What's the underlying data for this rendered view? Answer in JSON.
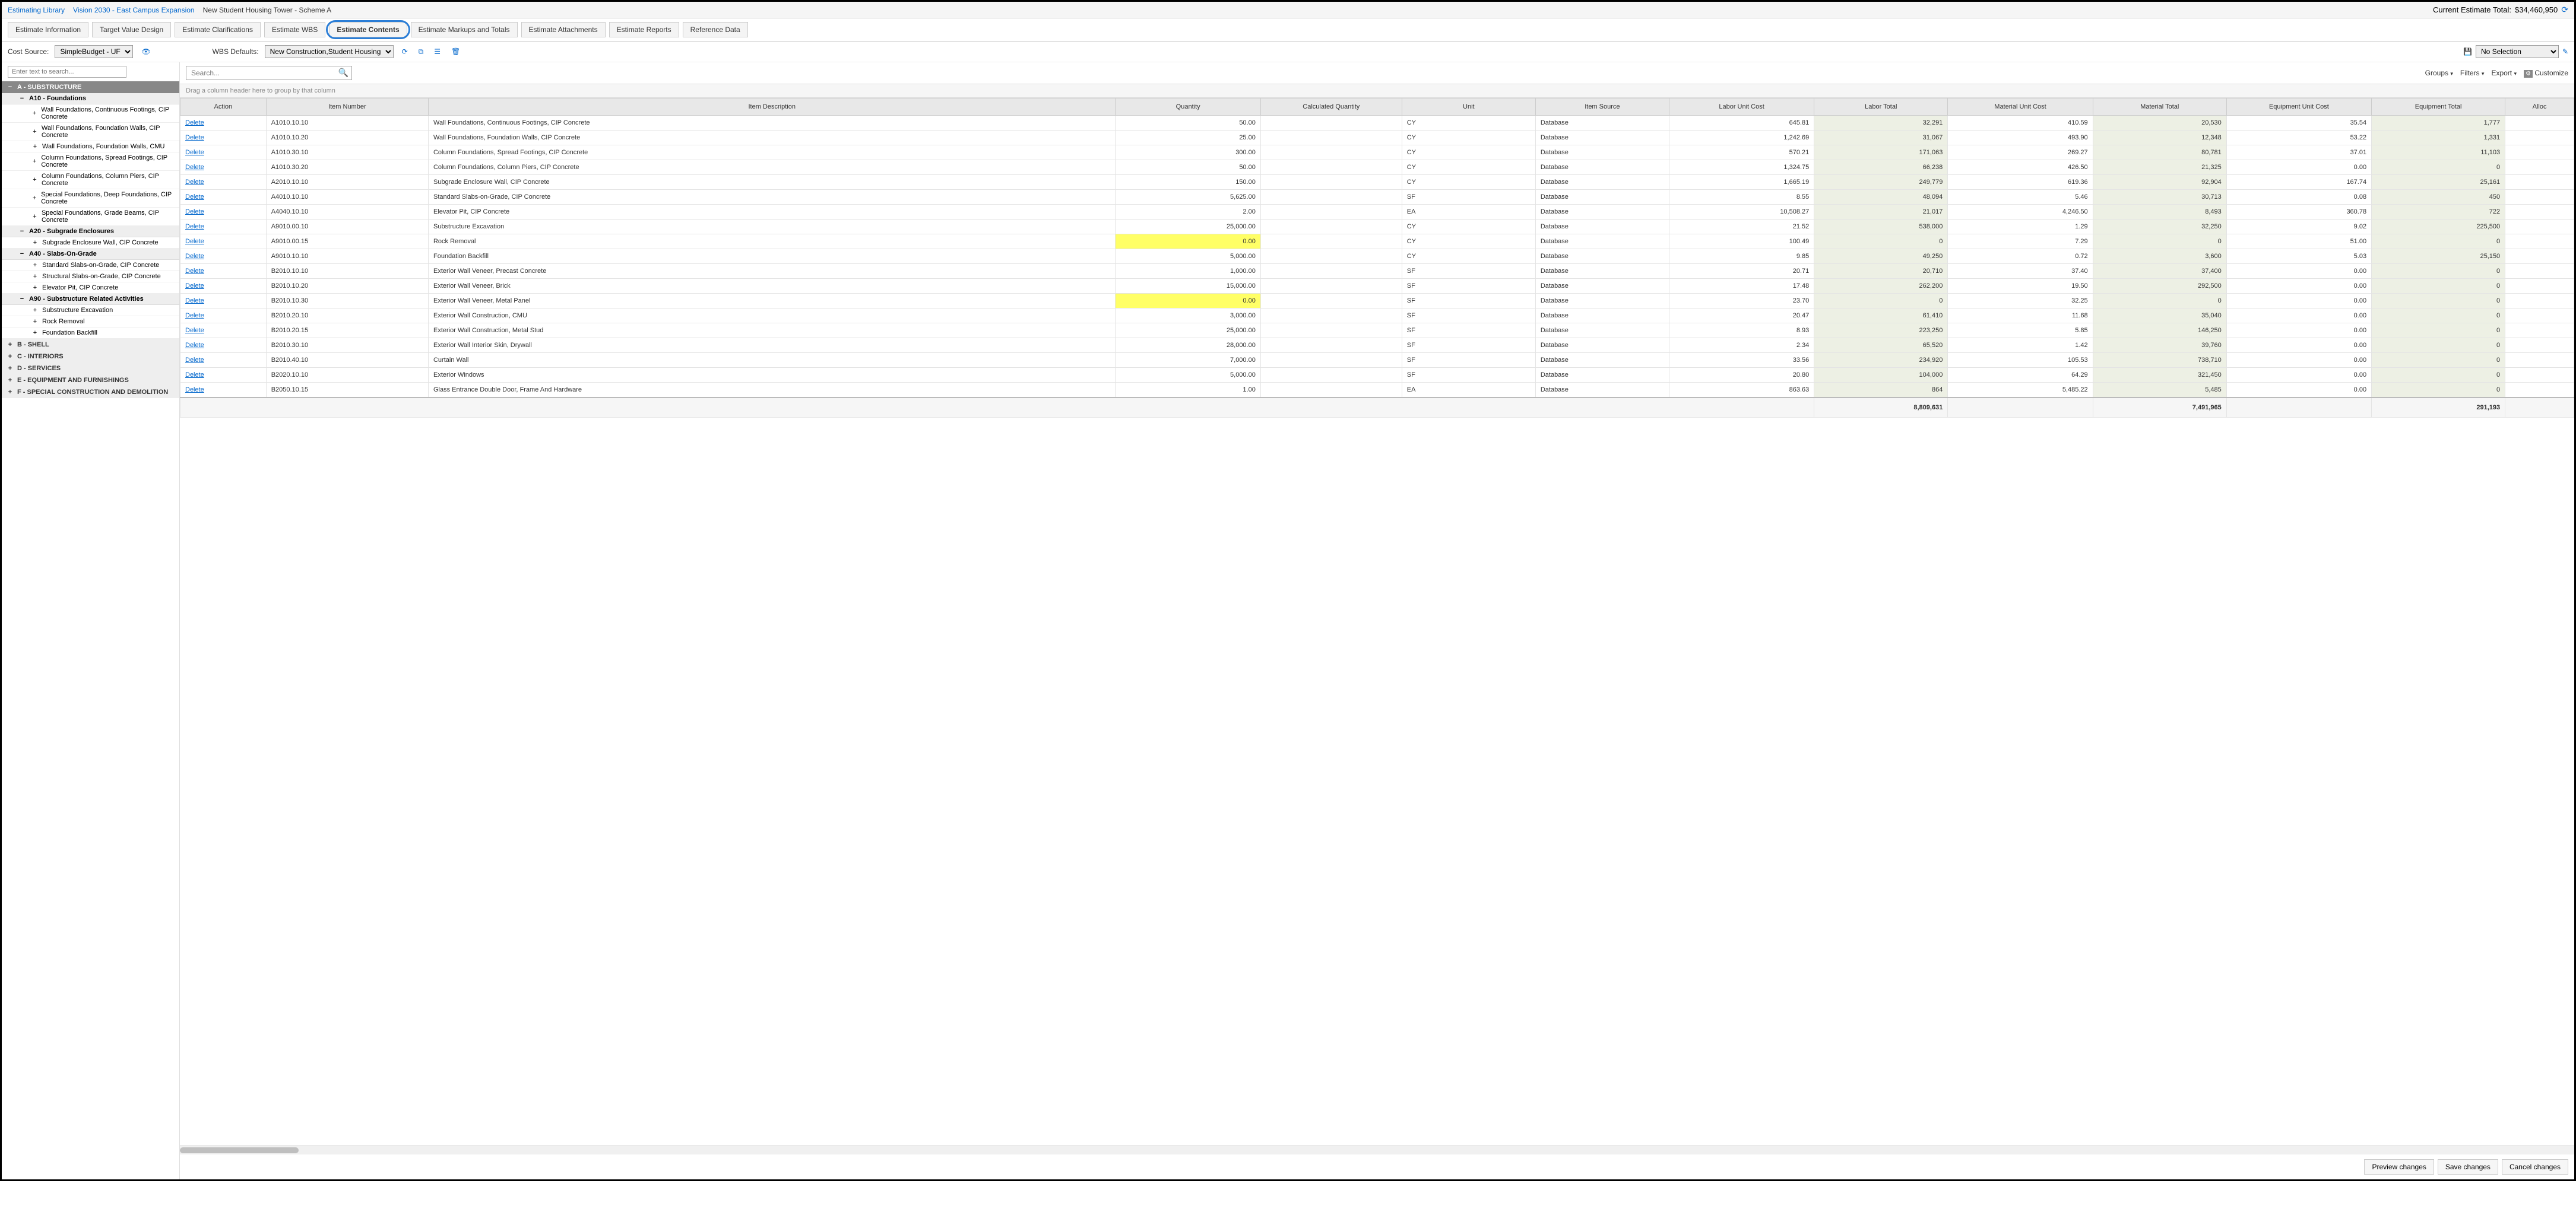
{
  "breadcrumb": {
    "libLabel": "Estimating Library",
    "programLabel": "Vision 2030 - East Campus Expansion",
    "projectLabel": "New Student Housing Tower - Scheme A"
  },
  "totalLabel": "Current Estimate Total:",
  "totalValue": "$34,460,950",
  "tabs": [
    "Estimate Information",
    "Target Value Design",
    "Estimate Clarifications",
    "Estimate WBS",
    "Estimate Contents",
    "Estimate Markups and Totals",
    "Estimate Attachments",
    "Estimate Reports",
    "Reference Data"
  ],
  "activeTabIndex": 4,
  "costSourceLabel": "Cost Source:",
  "costSourceValue": "SimpleBudget - UF",
  "wbsDefaultsLabel": "WBS Defaults:",
  "wbsDefaultsValue": "New Construction,Student Housing",
  "noSelectionLabel": "No Selection",
  "sidebarSearchPlaceholder": "Enter text to search...",
  "tree": {
    "A": {
      "title": "A - SUBSTRUCTURE",
      "A10": {
        "title": "A10 - Foundations",
        "items": [
          "Wall Foundations, Continuous Footings, CIP Concrete",
          "Wall Foundations, Foundation Walls, CIP Concrete",
          "Wall Foundations, Foundation Walls, CMU",
          "Column Foundations, Spread Footings, CIP Concrete",
          "Column Foundations, Column Piers, CIP Concrete",
          "Special Foundations, Deep Foundations, CIP Concrete",
          "Special Foundations, Grade Beams, CIP Concrete"
        ]
      },
      "A20": {
        "title": "A20 - Subgrade Enclosures",
        "items": [
          "Subgrade Enclosure Wall, CIP Concrete"
        ]
      },
      "A40": {
        "title": "A40 - Slabs-On-Grade",
        "items": [
          "Standard Slabs-on-Grade, CIP Concrete",
          "Structural Slabs-on-Grade, CIP Concrete",
          "Elevator Pit, CIP Concrete"
        ]
      },
      "A90": {
        "title": "A90 - Substructure Related Activities",
        "items": [
          "Substructure Excavation",
          "Rock Removal",
          "Foundation Backfill"
        ]
      }
    },
    "B": "B - SHELL",
    "C": "C - INTERIORS",
    "D": "D - SERVICES",
    "E": "E - EQUIPMENT AND FURNISHINGS",
    "F": "F - SPECIAL CONSTRUCTION AND DEMOLITION"
  },
  "contentSearchPlaceholder": "Search...",
  "toolbarRight": {
    "groups": "Groups",
    "filters": "Filters",
    "export": "Export",
    "customize": "Customize"
  },
  "groupBarText": "Drag a column header here to group by that column",
  "columns": [
    "Action",
    "Item Number",
    "Item Description",
    "Quantity",
    "Calculated Quantity",
    "Unit",
    "Item Source",
    "Labor Unit Cost",
    "Labor Total",
    "Material Unit Cost",
    "Material Total",
    "Equipment Unit Cost",
    "Equipment Total",
    "Alloc"
  ],
  "deleteLabel": "Delete",
  "rows": [
    {
      "num": "A1010.10.10",
      "desc": "Wall Foundations, Continuous Footings, CIP Concrete",
      "qty": "50.00",
      "unit": "CY",
      "src": "Database",
      "luc": "645.81",
      "lt": "32,291",
      "muc": "410.59",
      "mt": "20,530",
      "euc": "35.54",
      "et": "1,777"
    },
    {
      "num": "A1010.10.20",
      "desc": "Wall Foundations, Foundation Walls, CIP Concrete",
      "qty": "25.00",
      "unit": "CY",
      "src": "Database",
      "luc": "1,242.69",
      "lt": "31,067",
      "muc": "493.90",
      "mt": "12,348",
      "euc": "53.22",
      "et": "1,331"
    },
    {
      "num": "A1010.30.10",
      "desc": "Column Foundations, Spread Footings, CIP Concrete",
      "qty": "300.00",
      "unit": "CY",
      "src": "Database",
      "luc": "570.21",
      "lt": "171,063",
      "muc": "269.27",
      "mt": "80,781",
      "euc": "37.01",
      "et": "11,103"
    },
    {
      "num": "A1010.30.20",
      "desc": "Column Foundations, Column Piers, CIP Concrete",
      "qty": "50.00",
      "unit": "CY",
      "src": "Database",
      "luc": "1,324.75",
      "lt": "66,238",
      "muc": "426.50",
      "mt": "21,325",
      "euc": "0.00",
      "et": "0"
    },
    {
      "num": "A2010.10.10",
      "desc": "Subgrade Enclosure Wall, CIP Concrete",
      "qty": "150.00",
      "unit": "CY",
      "src": "Database",
      "luc": "1,665.19",
      "lt": "249,779",
      "muc": "619.36",
      "mt": "92,904",
      "euc": "167.74",
      "et": "25,161"
    },
    {
      "num": "A4010.10.10",
      "desc": "Standard Slabs-on-Grade, CIP Concrete",
      "qty": "5,625.00",
      "unit": "SF",
      "src": "Database",
      "luc": "8.55",
      "lt": "48,094",
      "muc": "5.46",
      "mt": "30,713",
      "euc": "0.08",
      "et": "450"
    },
    {
      "num": "A4040.10.10",
      "desc": "Elevator Pit, CIP Concrete",
      "qty": "2.00",
      "unit": "EA",
      "src": "Database",
      "luc": "10,508.27",
      "lt": "21,017",
      "muc": "4,246.50",
      "mt": "8,493",
      "euc": "360.78",
      "et": "722"
    },
    {
      "num": "A9010.00.10",
      "desc": "Substructure Excavation",
      "qty": "25,000.00",
      "unit": "CY",
      "src": "Database",
      "luc": "21.52",
      "lt": "538,000",
      "muc": "1.29",
      "mt": "32,250",
      "euc": "9.02",
      "et": "225,500"
    },
    {
      "num": "A9010.00.15",
      "desc": "Rock Removal",
      "qty": "0.00",
      "qtyYellow": true,
      "unit": "CY",
      "src": "Database",
      "luc": "100.49",
      "lt": "0",
      "muc": "7.29",
      "mt": "0",
      "euc": "51.00",
      "et": "0"
    },
    {
      "num": "A9010.10.10",
      "desc": "Foundation Backfill",
      "qty": "5,000.00",
      "unit": "CY",
      "src": "Database",
      "luc": "9.85",
      "lt": "49,250",
      "muc": "0.72",
      "mt": "3,600",
      "euc": "5.03",
      "et": "25,150"
    },
    {
      "num": "B2010.10.10",
      "desc": "Exterior Wall Veneer, Precast Concrete",
      "qty": "1,000.00",
      "unit": "SF",
      "src": "Database",
      "luc": "20.71",
      "lt": "20,710",
      "muc": "37.40",
      "mt": "37,400",
      "euc": "0.00",
      "et": "0"
    },
    {
      "num": "B2010.10.20",
      "desc": "Exterior Wall Veneer, Brick",
      "qty": "15,000.00",
      "unit": "SF",
      "src": "Database",
      "luc": "17.48",
      "lt": "262,200",
      "muc": "19.50",
      "mt": "292,500",
      "euc": "0.00",
      "et": "0"
    },
    {
      "num": "B2010.10.30",
      "desc": "Exterior Wall Veneer, Metal Panel",
      "qty": "0.00",
      "qtyYellow": true,
      "unit": "SF",
      "src": "Database",
      "luc": "23.70",
      "lt": "0",
      "muc": "32.25",
      "mt": "0",
      "euc": "0.00",
      "et": "0"
    },
    {
      "num": "B2010.20.10",
      "desc": "Exterior Wall Construction, CMU",
      "qty": "3,000.00",
      "unit": "SF",
      "src": "Database",
      "luc": "20.47",
      "lt": "61,410",
      "muc": "11.68",
      "mt": "35,040",
      "euc": "0.00",
      "et": "0"
    },
    {
      "num": "B2010.20.15",
      "desc": "Exterior Wall Construction, Metal Stud",
      "qty": "25,000.00",
      "unit": "SF",
      "src": "Database",
      "luc": "8.93",
      "lt": "223,250",
      "muc": "5.85",
      "mt": "146,250",
      "euc": "0.00",
      "et": "0"
    },
    {
      "num": "B2010.30.10",
      "desc": "Exterior Wall Interior Skin, Drywall",
      "qty": "28,000.00",
      "unit": "SF",
      "src": "Database",
      "luc": "2.34",
      "lt": "65,520",
      "muc": "1.42",
      "mt": "39,760",
      "euc": "0.00",
      "et": "0"
    },
    {
      "num": "B2010.40.10",
      "desc": "Curtain Wall",
      "qty": "7,000.00",
      "unit": "SF",
      "src": "Database",
      "luc": "33.56",
      "lt": "234,920",
      "muc": "105.53",
      "mt": "738,710",
      "euc": "0.00",
      "et": "0"
    },
    {
      "num": "B2020.10.10",
      "desc": "Exterior Windows",
      "qty": "5,000.00",
      "unit": "SF",
      "src": "Database",
      "luc": "20.80",
      "lt": "104,000",
      "muc": "64.29",
      "mt": "321,450",
      "euc": "0.00",
      "et": "0"
    },
    {
      "num": "B2050.10.15",
      "desc": "Glass Entrance Double Door, Frame And Hardware",
      "qty": "1.00",
      "unit": "EA",
      "src": "Database",
      "luc": "863.63",
      "lt": "864",
      "muc": "5,485.22",
      "mt": "5,485",
      "euc": "0.00",
      "et": "0"
    }
  ],
  "footer": {
    "lt": "8,809,631",
    "mt": "7,491,965",
    "et": "291,193"
  },
  "buttons": {
    "preview": "Preview changes",
    "save": "Save changes",
    "cancel": "Cancel changes"
  }
}
